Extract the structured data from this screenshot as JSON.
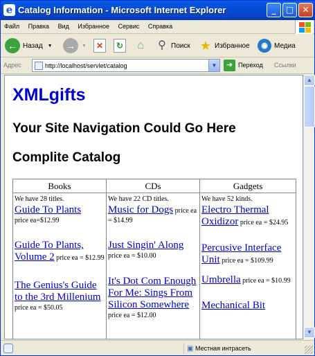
{
  "window": {
    "title": "Catalog Information - Microsoft Internet Explorer",
    "buttons": {
      "minimize": "_",
      "maximize": "□",
      "close": "✕"
    }
  },
  "menu": [
    "Файл",
    "Правка",
    "Вид",
    "Избранное",
    "Сервис",
    "Справка"
  ],
  "toolbar": {
    "back_label": "Назад",
    "search_label": "Поиск",
    "favorites_label": "Избранное",
    "media_label": "Медиа"
  },
  "addressbar": {
    "label": "Адрес",
    "url": "http://localhost/servlet/catalog",
    "go_label": "Переход",
    "links_label": "Ссылки"
  },
  "page": {
    "site_title": "XMLgifts",
    "nav_heading": "Your Site Navigation Could Go Here",
    "catalog_heading": "Complite Catalog",
    "columns": [
      {
        "header": "Books",
        "count": "We have 28 titles.",
        "items": [
          {
            "name": "Guide To Plants",
            "price": "price ea=$12.99"
          },
          {
            "name": "Guide To Plants, Volume 2",
            "price": "price ea = $12.99"
          },
          {
            "name": "The Genius's Guide to the 3rd Millenium",
            "price": "price ea = $50.05"
          }
        ]
      },
      {
        "header": "CDs",
        "count": "We have 22 CD titles.",
        "items": [
          {
            "name": "Music for Dogs",
            "price": "price ea = $14.99"
          },
          {
            "name": "Just Singin' Along",
            "price": "price ea = $10.00"
          },
          {
            "name": "It's Dot Com Enough For Me: Sings From Silicon Somewhere",
            "price": "price ea = $12.00"
          }
        ]
      },
      {
        "header": "Gadgets",
        "count": "We have 52 kinds.",
        "items": [
          {
            "name": "Electro Thermal Oxidizor",
            "price": "price ea = $24.95"
          },
          {
            "name": "Percusive Interface Unit",
            "price": "price ea = $109.99"
          },
          {
            "name": "Umbrella",
            "price": "price ea = $10.99"
          },
          {
            "name": "Mechanical Bit",
            "price": ""
          }
        ]
      }
    ]
  },
  "status": {
    "zone": "Местная интрасеть"
  },
  "colors": {
    "link": "#0000CC",
    "titlebar": "#0550D8",
    "chrome": "#ECE9D8"
  }
}
